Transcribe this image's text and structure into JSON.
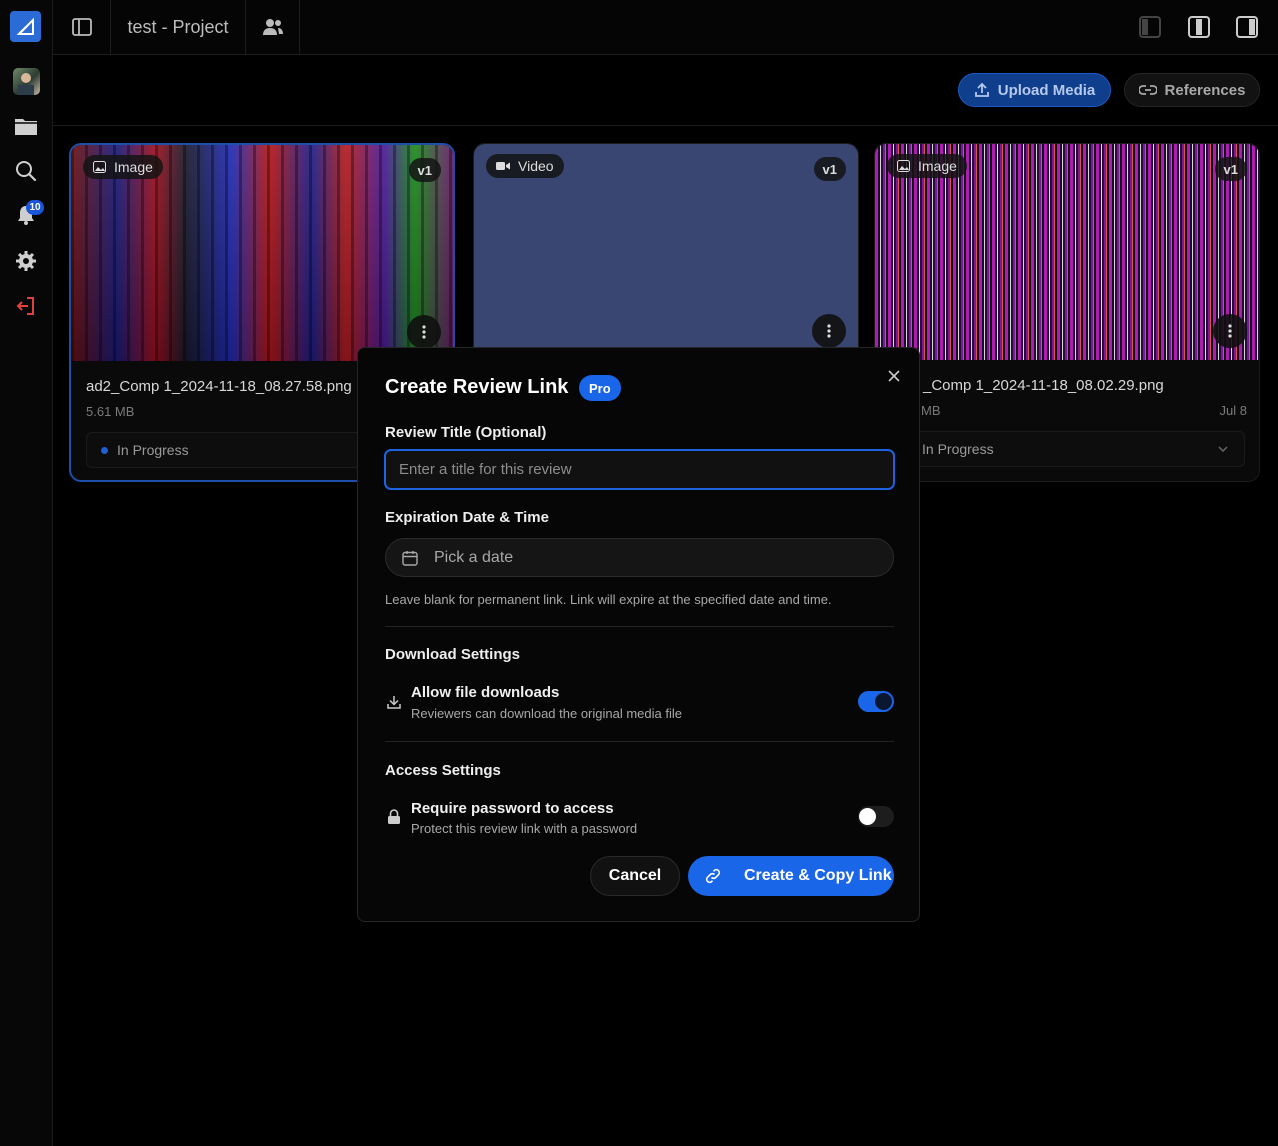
{
  "topbar": {
    "project_title": "test - Project"
  },
  "sidebar": {
    "notification_count": "10"
  },
  "actions": {
    "upload_label": "Upload Media",
    "references_label": "References"
  },
  "cards": [
    {
      "type": "Image",
      "version": "v1",
      "name": "ad2_Comp 1_2024-11-18_08.27.58.png",
      "size": "5.61 MB",
      "date": "",
      "status": "In Progress"
    },
    {
      "type": "Video",
      "version": "v1",
      "name": "",
      "size": "",
      "date": "",
      "status": ""
    },
    {
      "type": "Image",
      "version": "v1",
      "name": "_Comp 1_2024-11-18_08.02.29.png",
      "size": "MB",
      "date": "Jul 8",
      "status": "In Progress"
    }
  ],
  "modal": {
    "title": "Create Review Link",
    "badge": "Pro",
    "review_title_label": "Review Title (Optional)",
    "review_title_placeholder": "Enter a title for this review",
    "review_title_value": "",
    "expiration_label": "Expiration Date & Time",
    "date_placeholder": "Pick a date",
    "expiration_hint": "Leave blank for permanent link. Link will expire at the specified date and time.",
    "download_section": "Download Settings",
    "download_title": "Allow file downloads",
    "download_desc": "Reviewers can download the original media file",
    "download_enabled": true,
    "access_section": "Access Settings",
    "password_title": "Require password to access",
    "password_desc": "Protect this review link with a password",
    "password_enabled": false,
    "cancel_label": "Cancel",
    "create_label": "Create & Copy Link"
  },
  "colors": {
    "accent": "#1a66e8",
    "background": "#000000",
    "logout": "#e0413a"
  }
}
